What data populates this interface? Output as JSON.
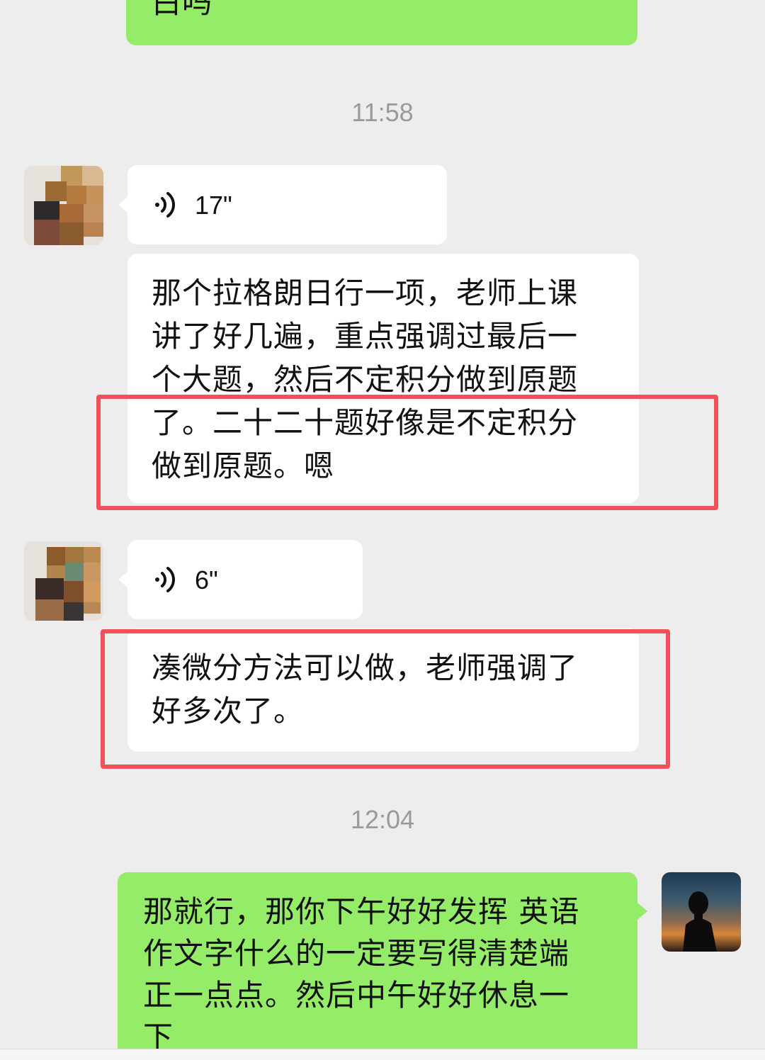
{
  "top_partial_message": {
    "text": "白吗"
  },
  "timestamps": [
    "11:58",
    "12:04"
  ],
  "messages": [
    {
      "from": "other",
      "type": "voice",
      "duration": "17\""
    },
    {
      "from": "other",
      "type": "text",
      "lines": [
        "那个拉格朗日行一项，老师上课",
        "讲了好几遍，重点强调过最后一",
        "个大题，然后不定积分做到原题",
        "了。二十二十题好像是不定积分",
        "做到原题。嗯"
      ]
    },
    {
      "from": "other",
      "type": "voice",
      "duration": "6\""
    },
    {
      "from": "other",
      "type": "text",
      "lines": [
        "凑微分方法可以做，老师强调了",
        "好多次了。"
      ]
    },
    {
      "from": "me",
      "type": "text",
      "lines": [
        "那就行，那你下午好好发挥 英语",
        "作文字什么的一定要写得清楚端",
        "正一点点。然后中午好好休息一",
        "下"
      ]
    }
  ],
  "colors": {
    "background": "#ededed",
    "incoming": "#ffffff",
    "outgoing": "#95ec69",
    "highlight": "#f0515a",
    "timestamp": "#9a9a9a"
  }
}
